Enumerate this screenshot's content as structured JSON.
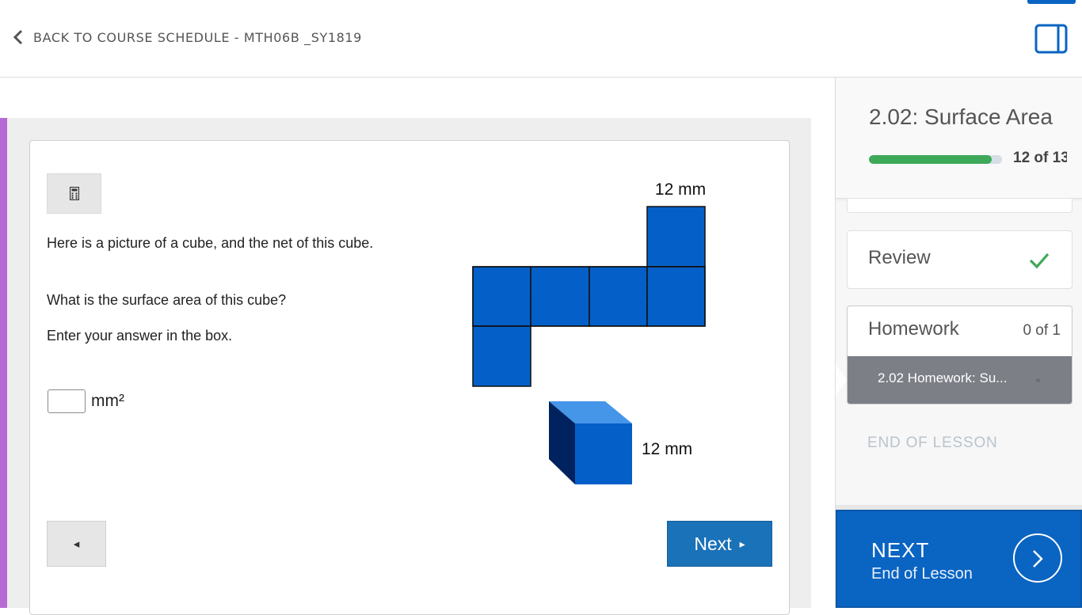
{
  "header": {
    "back_label": "BACK TO COURSE SCHEDULE - MTH06B _SY1819",
    "back_icon": "chevron-left-icon",
    "panel_icon": "panel-toggle-icon"
  },
  "question": {
    "calculator_icon": "calculator-icon",
    "text_1": "Here is a picture of a cube, and the net of this cube.",
    "text_2": "What is the surface area of this cube?",
    "text_3": "Enter your answer in the box.",
    "answer_value": "",
    "unit": "mm²",
    "diagram": {
      "net_label": "12 mm",
      "cube_label": "12 mm",
      "fill_color": "#0460c8"
    },
    "prev_icon": "◂",
    "next_label": "Next",
    "next_icon": "▸"
  },
  "sidebar": {
    "lesson_title": "2.02: Surface Area",
    "progress_text": "12 of 13",
    "progress_fraction": 0.92,
    "progress_color": "#3fa95a",
    "review_label": "Review",
    "review_icon": "checkmark-icon",
    "homework_label": "Homework",
    "homework_count": "0 of 1",
    "homework_item": "2.02 Homework: Su...",
    "end_of_lesson": "END OF LESSON"
  },
  "next_panel": {
    "title": "NEXT",
    "subtitle": "End of Lesson",
    "icon": "chevron-right-circle-icon",
    "color": "#0a64c2"
  }
}
